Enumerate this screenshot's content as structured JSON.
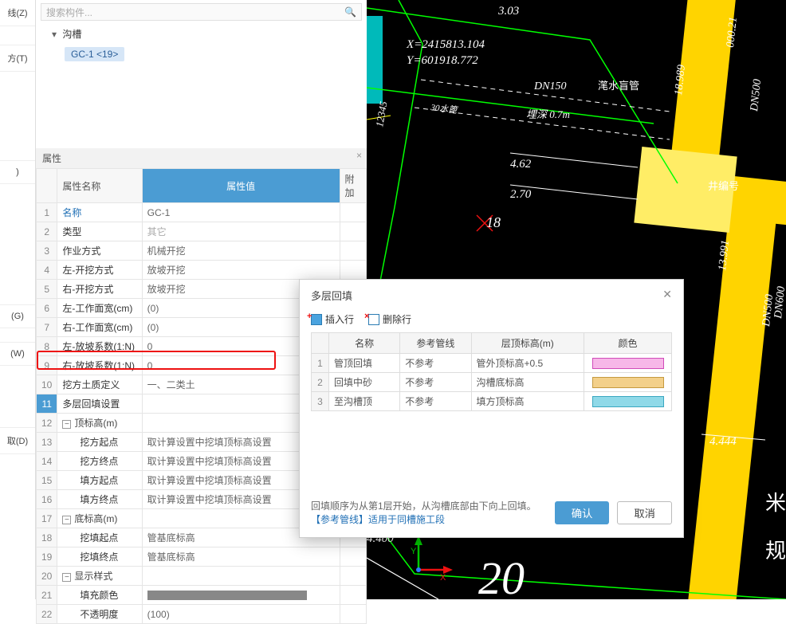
{
  "left_toolbar": [
    "线(Z)",
    "",
    "方(T)",
    "",
    "",
    "",
    "",
    "",
    "",
    "(G)",
    "",
    "(W)",
    "",
    "取(D)"
  ],
  "search": {
    "placeholder": "搜索构件...",
    "icon": "search"
  },
  "tree": {
    "root": "沟槽",
    "chip": "GC-1 <19>"
  },
  "props_panel": {
    "title": "属性",
    "headers": {
      "idx": "",
      "name": "属性名称",
      "value": "属性值",
      "extra": "附加"
    },
    "rows": [
      {
        "n": "1",
        "name": "名称",
        "value": "GC-1",
        "link": true
      },
      {
        "n": "2",
        "name": "类型",
        "value": "其它",
        "gray": true
      },
      {
        "n": "3",
        "name": "作业方式",
        "value": "机械开挖"
      },
      {
        "n": "4",
        "name": "左-开挖方式",
        "value": "放坡开挖"
      },
      {
        "n": "5",
        "name": "右-开挖方式",
        "value": "放坡开挖"
      },
      {
        "n": "6",
        "name": "左-工作面宽(cm)",
        "value": "(0)"
      },
      {
        "n": "7",
        "name": "右-工作面宽(cm)",
        "value": "(0)"
      },
      {
        "n": "8",
        "name": "左-放坡系数(1:N)",
        "value": "0"
      },
      {
        "n": "9",
        "name": "右-放坡系数(1:N)",
        "value": "0"
      },
      {
        "n": "10",
        "name": "挖方土质定义",
        "value": "一、二类土"
      },
      {
        "n": "11",
        "name": "多层回填设置",
        "value": "",
        "selected": true
      },
      {
        "n": "12",
        "name": "顶标高(m)",
        "value": "",
        "group": true
      },
      {
        "n": "13",
        "name": "挖方起点",
        "value": "取计算设置中挖填顶标高设置",
        "indent": true
      },
      {
        "n": "14",
        "name": "挖方终点",
        "value": "取计算设置中挖填顶标高设置",
        "indent": true
      },
      {
        "n": "15",
        "name": "填方起点",
        "value": "取计算设置中挖填顶标高设置",
        "indent": true
      },
      {
        "n": "16",
        "name": "填方终点",
        "value": "取计算设置中挖填顶标高设置",
        "indent": true
      },
      {
        "n": "17",
        "name": "底标高(m)",
        "value": "",
        "group": true
      },
      {
        "n": "18",
        "name": "挖填起点",
        "value": "管基底标高",
        "indent": true
      },
      {
        "n": "19",
        "name": "挖填终点",
        "value": "管基底标高",
        "indent": true
      },
      {
        "n": "20",
        "name": "显示样式",
        "value": "",
        "group": true
      },
      {
        "n": "21",
        "name": "填充颜色",
        "value": "[colorbar]",
        "indent": true,
        "colorbar": true
      },
      {
        "n": "22",
        "name": "不透明度",
        "value": "(100)",
        "indent": true
      }
    ]
  },
  "dialog": {
    "title": "多层回填",
    "insert_row": "插入行",
    "delete_row": "删除行",
    "headers": {
      "name": "名称",
      "ref": "参考管线",
      "elev": "层顶标高(m)",
      "color": "颜色"
    },
    "rows": [
      {
        "n": "1",
        "name": "管顶回填",
        "ref": "不参考",
        "elev": "管外顶标高+0.5",
        "swatch": "pink"
      },
      {
        "n": "2",
        "name": "回填中砂",
        "ref": "不参考",
        "elev": "沟槽底标高",
        "swatch": "tan",
        "highlight": true
      },
      {
        "n": "3",
        "name": "至沟槽顶",
        "ref": "不参考",
        "elev": "填方顶标高",
        "swatch": "cyan"
      }
    ],
    "note1": "回填顺序为从第1层开始，从沟槽底部由下向上回填。",
    "note2": "【参考管线】适用于同槽施工段",
    "ok": "确认",
    "cancel": "取消"
  },
  "cad": {
    "coords_x": "X=2415813.104",
    "coords_y": "Y=601918.772",
    "dim_303": "3.03",
    "dn150": "DN150",
    "pipe_label": "滗水盲管",
    "depth_lbl": "埋深   0.7m",
    "width_lbl": "30水篦",
    "dim_462": "4.62",
    "dim_270": "2.70",
    "num_18": "18",
    "well_lbl": "井编号",
    "dim_13991": "13.991",
    "dim_18989": "18.989",
    "dim_00021": "000.21",
    "dn500a": "DN500",
    "dn500b": "DN500",
    "dn600": "DN600",
    "dim_4444": "4.444",
    "dim_4400": "4.400",
    "meter": "米",
    "gui": "规",
    "num_12345": "12345",
    "big20": "20"
  }
}
